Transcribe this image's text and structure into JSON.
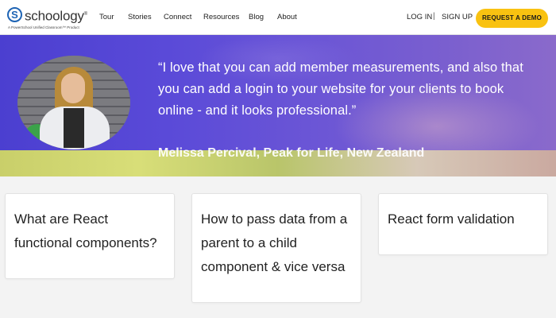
{
  "header": {
    "logo_word": "schoology",
    "logo_mark": "S",
    "logo_tagline": "A PowerSchool Unified Classroom™ Product",
    "nav": [
      "Tour",
      "Stories",
      "Connect",
      "Resources",
      "Blog",
      "About"
    ],
    "login": "LOG IN",
    "divider": "|",
    "signup": "SIGN UP",
    "demo": "REQUEST A DEMO"
  },
  "hero": {
    "quote": "“I love that you can add member measurements, and also that you can add a login to your website for your clients to book online - and it looks professional.”",
    "attribution": "Melissa Percival, Peak for Life, New Zealand"
  },
  "cards": [
    {
      "title": "What are React functional components?"
    },
    {
      "title": "How to pass data from a parent to a child component & vice versa"
    },
    {
      "title": "React form validation"
    }
  ],
  "colors": {
    "brand_blue": "#1e64b4",
    "demo_button": "#f9c211",
    "hero_purple": "#5a4ad8"
  }
}
